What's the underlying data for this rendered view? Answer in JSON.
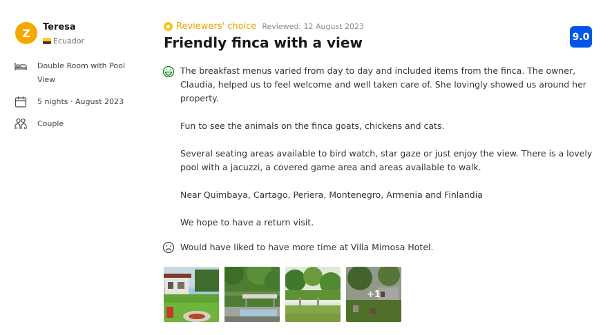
{
  "reviewer": {
    "initial": "Z",
    "name": "Teresa",
    "country": "Ecuador",
    "avatar_color": "#f5a800"
  },
  "stay": {
    "room": "Double Room with Pool View",
    "nights": "5 nights · August 2023",
    "traveler_type": "Couple"
  },
  "review": {
    "badge": "Reviewers' choice",
    "date": "Reviewed: 12 August 2023",
    "title": "Friendly finca with a view",
    "score": "9.0",
    "liked_paragraphs": [
      "The breakfast menus varied from day to day and included items from the finca. The owner, Claudia, helped us to feel welcome and well taken care of. She lovingly showed us around her property.",
      "Fun to see the animals on the finca goats, chickens and cats.",
      "Several seating areas available to bird watch, star gaze or just enjoy the view. There is a lovely pool with a jacuzzi, a covered game area and areas available to walk.",
      "Near Quimbaya, Cartago, Periera, Montenegro, Armenia and Finlandia",
      "We hope to have a return visit."
    ],
    "disliked": "Would have liked to have more time at Villa Mimosa Hotel."
  },
  "photos": {
    "more_count": "+1"
  },
  "icons": {
    "room": "bed-icon",
    "stay": "calendar-icon",
    "traveler": "group-icon",
    "liked": "smile-icon",
    "disliked": "frown-icon",
    "badge": "star-icon"
  },
  "colors": {
    "score_bg": "#0057e7",
    "badge_text": "#e7a600",
    "liked_icon": "#008009"
  }
}
